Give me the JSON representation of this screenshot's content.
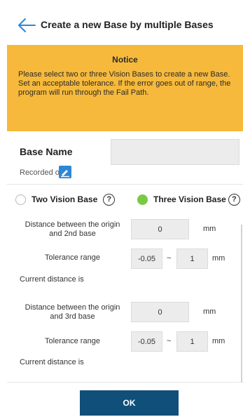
{
  "header": {
    "title": "Create a new Base by multiple Bases",
    "back_icon": "arrow-left-icon"
  },
  "notice": {
    "title": "Notice",
    "line1": "Please select two or three Vision Bases to create a new Base.",
    "line2": "Set an acceptable tolerance. If the error goes out of range, the program will run through the Fail Path."
  },
  "base_name": {
    "label": "Base Name",
    "value": ""
  },
  "recorded": {
    "label": "Recorded on",
    "icon": "record-icon"
  },
  "modes": {
    "two": {
      "label": "Two Vision Base",
      "selected": false
    },
    "three": {
      "label": "Three Vision Base",
      "selected": true
    },
    "help_glyph": "?"
  },
  "base2": {
    "distance_label": "Distance between the origin and 2nd base",
    "distance_value": "0",
    "unit": "mm",
    "tolerance_label": "Tolerance range",
    "tol_min": "-0.05",
    "separator": "~",
    "tol_max": "1",
    "tol_unit": "mm",
    "current_label": "Current distance is"
  },
  "base3": {
    "distance_label": "Distance between the origin and 3rd base",
    "distance_value": "0",
    "unit": "mm",
    "tolerance_label": "Tolerance range",
    "tol_min": "-0.05",
    "separator": "~",
    "tol_max": "1",
    "tol_unit": "mm",
    "current_label": "Current distance is"
  },
  "ok_label": "OK",
  "colors": {
    "notice_bg": "#f6b93b",
    "accent_green": "#7ac943",
    "button_bg": "#0f4f7a",
    "back_arrow": "#2d87d7"
  }
}
